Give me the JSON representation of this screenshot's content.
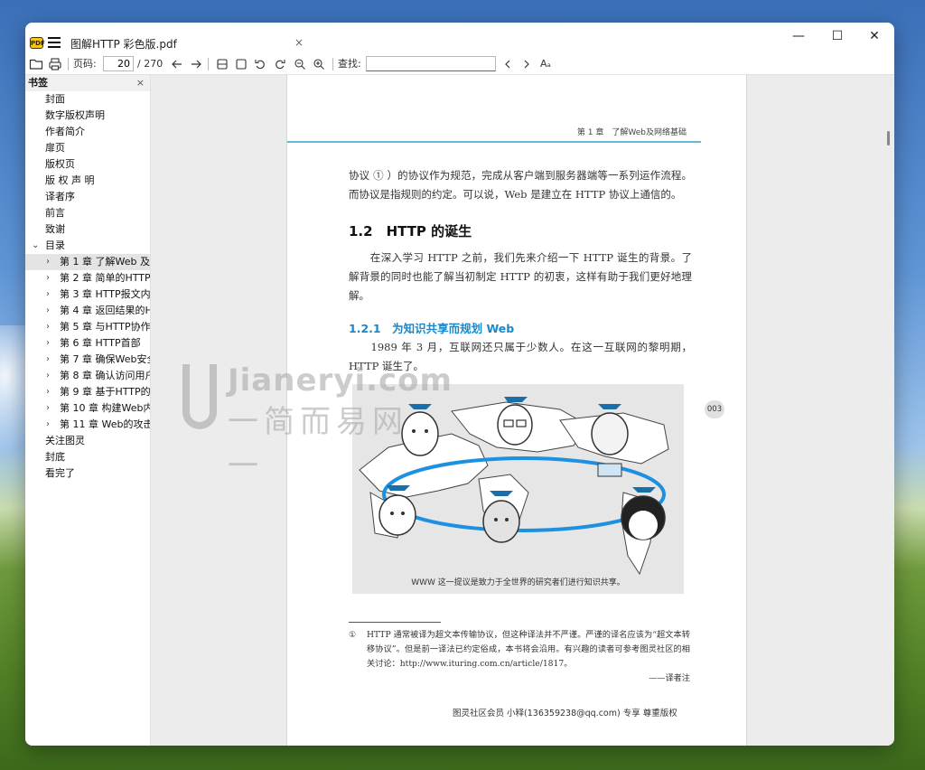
{
  "window": {
    "tab_title": "图解HTTP 彩色版.pdf",
    "tab_close": "×",
    "minimize": "—",
    "maximize": "☐",
    "close": "✕"
  },
  "toolbar": {
    "page_label": "页码:",
    "page_value": "20",
    "page_total": "/ 270",
    "search_label": "查找:",
    "search_value": "",
    "font_icon_label": "Aₐ"
  },
  "sidebar": {
    "title": "书签",
    "close": "×",
    "items": [
      {
        "label": "封面",
        "level": 0,
        "chevron": ""
      },
      {
        "label": "数字版权声明",
        "level": 0,
        "chevron": ""
      },
      {
        "label": "作者简介",
        "level": 0,
        "chevron": ""
      },
      {
        "label": "扉页",
        "level": 0,
        "chevron": ""
      },
      {
        "label": "版权页",
        "level": 0,
        "chevron": ""
      },
      {
        "label": "版 权 声 明",
        "level": 0,
        "chevron": ""
      },
      {
        "label": "译者序",
        "level": 0,
        "chevron": ""
      },
      {
        "label": "前言",
        "level": 0,
        "chevron": ""
      },
      {
        "label": "致谢",
        "level": 0,
        "chevron": ""
      },
      {
        "label": "目录",
        "level": 0,
        "chevron": "v"
      },
      {
        "label": "第 1 章 了解Web 及",
        "level": 1,
        "chevron": ">",
        "selected": true
      },
      {
        "label": "第 2 章 简单的HTTP",
        "level": 1,
        "chevron": ">"
      },
      {
        "label": "第 3 章 HTTP报文内",
        "level": 1,
        "chevron": ">"
      },
      {
        "label": "第 4 章 返回结果的H",
        "level": 1,
        "chevron": ">"
      },
      {
        "label": "第 5 章 与HTTP协作",
        "level": 1,
        "chevron": ">"
      },
      {
        "label": "第 6 章 HTTP首部",
        "level": 1,
        "chevron": ">"
      },
      {
        "label": "第 7 章 确保Web安全",
        "level": 1,
        "chevron": ">"
      },
      {
        "label": "第 8 章 确认访问用户",
        "level": 1,
        "chevron": ">"
      },
      {
        "label": "第 9 章 基于HTTP的",
        "level": 1,
        "chevron": ">"
      },
      {
        "label": "第 10 章 构建Web内",
        "level": 1,
        "chevron": ">"
      },
      {
        "label": "第 11 章 Web的攻击",
        "level": 1,
        "chevron": ">"
      },
      {
        "label": "关注图灵",
        "level": 0,
        "chevron": ""
      },
      {
        "label": "封底",
        "level": 0,
        "chevron": ""
      },
      {
        "label": "看完了",
        "level": 0,
        "chevron": ""
      }
    ]
  },
  "page": {
    "chapter_header": "第 1 章　了解Web及网络基础",
    "para1": "协议 ① ）的协议作为规范，完成从客户端到服务器端等一系列运作流程。而协议是指规则的约定。可以说，Web 是建立在 HTTP 协议上通信的。",
    "h2": "1.2　HTTP 的诞生",
    "para2": "　　在深入学习 HTTP 之前，我们先来介绍一下 HTTP 诞生的背景。了解背景的同时也能了解当初制定 HTTP 的初衷，这样有助于我们更好地理解。",
    "h3": "1.2.1　为知识共享而规划 Web",
    "para3": "　　1989 年 3 月，互联网还只属于少数人。在这一互联网的黎明期，HTTP 诞生了。",
    "figure_caption": "WWW 这一提议是致力于全世界的研究者们进行知识共享。",
    "page_number": "003",
    "footnote_mark": "①",
    "footnote_text": "HTTP 通常被译为超文本传输协议，但这种译法并不严谨。严谨的译名应该为“超文本转移协议”。但是前一译法已约定俗成，本书将会沿用。有兴趣的读者可参考图灵社区的相关讨论：http://www.ituring.com.cn/article/1817。",
    "footnote_sign": "——译者注",
    "footer": "图灵社区会员 小释(136359238@qq.com) 专享 尊重版权"
  },
  "watermark": {
    "brand": "Jianeryi.com",
    "sub": "一简而易网一"
  },
  "colors": {
    "accent_rule": "#63b8d8",
    "heading_blue": "#1a88c8",
    "globe_ring": "#1e90e0"
  }
}
